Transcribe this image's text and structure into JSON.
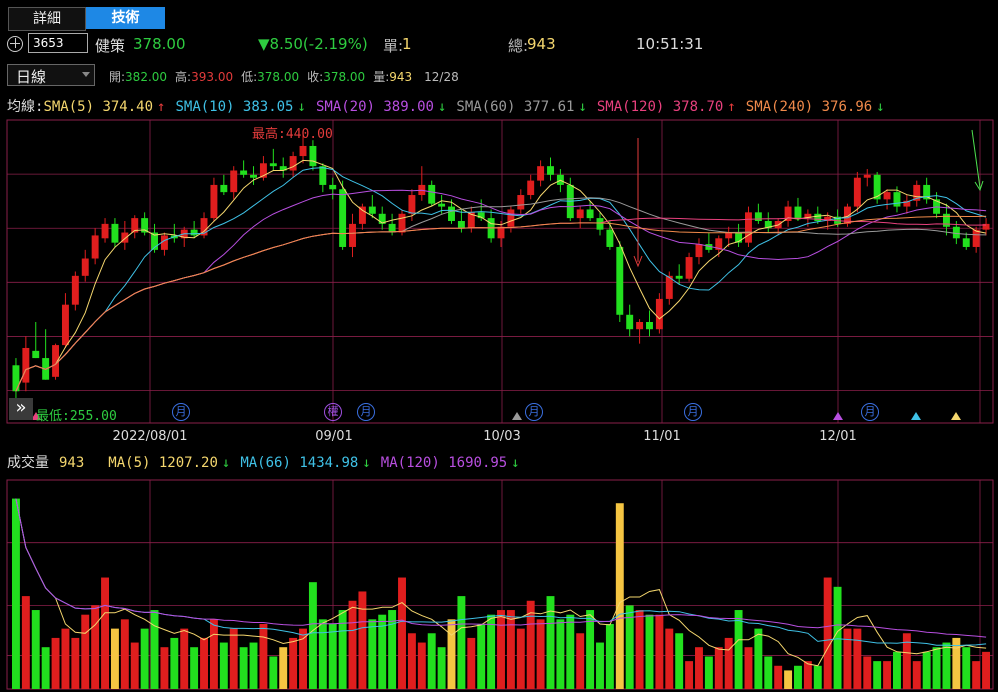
{
  "tabs": [
    {
      "label": "詳細",
      "active": false
    },
    {
      "label": "技術",
      "active": true
    }
  ],
  "quote": {
    "code": "3653",
    "name": "健策",
    "price": "378.00",
    "change": "▼8.50(-2.19%)",
    "unit_label": "單:",
    "unit_value": "1",
    "total_label": "總:",
    "total_value": "943",
    "time": "10:51:31"
  },
  "period": {
    "selected": "日線"
  },
  "ohlc": {
    "open_label": "開:",
    "open": "382.00",
    "high_label": "高:",
    "high": "393.00",
    "low_label": "低:",
    "low": "378.00",
    "close_label": "收:",
    "close": "378.00",
    "vol_label": "量:",
    "vol": "943",
    "date": "12/28"
  },
  "ma_title": "均線:",
  "ma": [
    {
      "label": "SMA(5)",
      "value": "374.40",
      "arrow": "↑",
      "color": "#f5d76e"
    },
    {
      "label": "SMA(10)",
      "value": "383.05",
      "arrow": "↓",
      "color": "#3fc1e6"
    },
    {
      "label": "SMA(20)",
      "value": "389.00",
      "arrow": "↓",
      "color": "#b84fe0"
    },
    {
      "label": "SMA(60)",
      "value": "377.61",
      "arrow": "↓",
      "color": "#9a9a9a"
    },
    {
      "label": "SMA(120)",
      "value": "378.70",
      "arrow": "↑",
      "color": "#e8417e"
    },
    {
      "label": "SMA(240)",
      "value": "376.96",
      "arrow": "↓",
      "color": "#f08a4b"
    }
  ],
  "annotations": {
    "high_label": "最高:",
    "high_value": "440.00",
    "low_label": "最低:",
    "low_value": "255.00",
    "expand_icon": "double-chevron-right-icon"
  },
  "event_markers": [
    {
      "label": "月",
      "type": "circle",
      "color": "#3a6fe0"
    },
    {
      "label": "權",
      "type": "circle",
      "color": "#a050e0"
    },
    {
      "label": "月",
      "type": "circle",
      "color": "#3a6fe0"
    },
    {
      "label": "月",
      "type": "circle",
      "color": "#3a6fe0"
    },
    {
      "label": "月",
      "type": "circle",
      "color": "#3a6fe0"
    },
    {
      "label": "月",
      "type": "circle",
      "color": "#3a6fe0"
    }
  ],
  "date_axis": [
    "2022/08/01",
    "09/01",
    "10/03",
    "11/01",
    "12/01"
  ],
  "volume_header": {
    "title": "成交量",
    "value": "943",
    "ma": [
      {
        "label": "MA(5)",
        "value": "1207.20",
        "arrow": "↓",
        "color": "#f5d76e"
      },
      {
        "label": "MA(66)",
        "value": "1434.98",
        "arrow": "↓",
        "color": "#3fc1e6"
      },
      {
        "label": "MA(120)",
        "value": "1690.95",
        "arrow": "↓",
        "color": "#b84fe0"
      }
    ]
  },
  "colors": {
    "up": "#e01e1e",
    "down": "#22e01e",
    "grid": "#8a1f4a",
    "text_green": "#2ecc40",
    "text_red": "#e23b3b",
    "text_yellow": "#f5d76e",
    "accent_tab": "#1e88e5"
  },
  "chart_data": {
    "type": "candlestick",
    "price_range": [
      240,
      450
    ],
    "volume_range": [
      0,
      4500
    ],
    "candles": [
      [
        280,
        285,
        250,
        262
      ],
      [
        268,
        300,
        262,
        292
      ],
      [
        290,
        310,
        285,
        285
      ],
      [
        285,
        305,
        270,
        270
      ],
      [
        272,
        295,
        270,
        294
      ],
      [
        294,
        330,
        292,
        322
      ],
      [
        322,
        345,
        318,
        342
      ],
      [
        342,
        360,
        338,
        354
      ],
      [
        354,
        375,
        350,
        370
      ],
      [
        368,
        382,
        365,
        378
      ],
      [
        378,
        382,
        362,
        365
      ],
      [
        365,
        380,
        360,
        372
      ],
      [
        372,
        384,
        368,
        382
      ],
      [
        382,
        386,
        370,
        372
      ],
      [
        372,
        378,
        358,
        360
      ],
      [
        360,
        372,
        356,
        370
      ],
      [
        370,
        378,
        365,
        368
      ],
      [
        368,
        376,
        362,
        374
      ],
      [
        374,
        380,
        368,
        370
      ],
      [
        370,
        386,
        368,
        382
      ],
      [
        382,
        410,
        380,
        405
      ],
      [
        405,
        412,
        398,
        400
      ],
      [
        400,
        418,
        395,
        415
      ],
      [
        415,
        422,
        410,
        412
      ],
      [
        412,
        418,
        405,
        410
      ],
      [
        410,
        425,
        408,
        420
      ],
      [
        420,
        430,
        415,
        418
      ],
      [
        418,
        424,
        410,
        415
      ],
      [
        415,
        428,
        410,
        425
      ],
      [
        425,
        440,
        420,
        432
      ],
      [
        432,
        436,
        415,
        418
      ],
      [
        418,
        420,
        400,
        405
      ],
      [
        405,
        410,
        395,
        402
      ],
      [
        402,
        408,
        360,
        362
      ],
      [
        362,
        385,
        355,
        378
      ],
      [
        378,
        392,
        374,
        390
      ],
      [
        390,
        398,
        382,
        385
      ],
      [
        385,
        390,
        374,
        378
      ],
      [
        378,
        385,
        370,
        372
      ],
      [
        372,
        388,
        370,
        385
      ],
      [
        385,
        402,
        380,
        398
      ],
      [
        398,
        418,
        394,
        405
      ],
      [
        405,
        408,
        390,
        392
      ],
      [
        392,
        398,
        385,
        390
      ],
      [
        390,
        395,
        378,
        380
      ],
      [
        380,
        388,
        372,
        375
      ],
      [
        375,
        390,
        372,
        386
      ],
      [
        386,
        395,
        380,
        382
      ],
      [
        382,
        388,
        365,
        368
      ],
      [
        368,
        380,
        362,
        376
      ],
      [
        376,
        390,
        372,
        388
      ],
      [
        388,
        402,
        385,
        398
      ],
      [
        398,
        412,
        395,
        408
      ],
      [
        408,
        422,
        404,
        418
      ],
      [
        418,
        424,
        408,
        412
      ],
      [
        412,
        416,
        400,
        405
      ],
      [
        405,
        410,
        380,
        382
      ],
      [
        382,
        390,
        375,
        388
      ],
      [
        388,
        394,
        380,
        382
      ],
      [
        382,
        386,
        370,
        374
      ],
      [
        374,
        380,
        360,
        362
      ],
      [
        362,
        366,
        310,
        315
      ],
      [
        315,
        322,
        300,
        305
      ],
      [
        305,
        312,
        295,
        310
      ],
      [
        310,
        318,
        300,
        305
      ],
      [
        305,
        330,
        302,
        326
      ],
      [
        326,
        345,
        322,
        342
      ],
      [
        342,
        350,
        336,
        340
      ],
      [
        340,
        358,
        338,
        355
      ],
      [
        355,
        368,
        350,
        364
      ],
      [
        364,
        372,
        358,
        360
      ],
      [
        360,
        370,
        355,
        368
      ],
      [
        368,
        376,
        362,
        372
      ],
      [
        372,
        378,
        362,
        365
      ],
      [
        365,
        390,
        362,
        386
      ],
      [
        386,
        392,
        378,
        380
      ],
      [
        380,
        386,
        372,
        375
      ],
      [
        375,
        382,
        370,
        380
      ],
      [
        380,
        394,
        376,
        390
      ],
      [
        390,
        396,
        380,
        382
      ],
      [
        382,
        388,
        376,
        385
      ],
      [
        385,
        390,
        378,
        380
      ],
      [
        380,
        386,
        374,
        383
      ],
      [
        383,
        388,
        376,
        378
      ],
      [
        378,
        392,
        376,
        390
      ],
      [
        390,
        414,
        386,
        410
      ],
      [
        410,
        416,
        404,
        412
      ],
      [
        412,
        414,
        392,
        395
      ],
      [
        395,
        402,
        388,
        400
      ],
      [
        400,
        404,
        386,
        390
      ],
      [
        390,
        398,
        385,
        394
      ],
      [
        394,
        408,
        390,
        405
      ],
      [
        405,
        410,
        392,
        395
      ],
      [
        395,
        400,
        382,
        385
      ],
      [
        385,
        392,
        370,
        376
      ],
      [
        376,
        380,
        364,
        368
      ],
      [
        368,
        372,
        360,
        362
      ],
      [
        362,
        376,
        358,
        374
      ],
      [
        374,
        382,
        370,
        378
      ]
    ],
    "volumes": [
      4100,
      2000,
      1700,
      900,
      1100,
      1300,
      1100,
      1600,
      1800,
      2400,
      1300,
      1500,
      1000,
      1300,
      1700,
      900,
      1100,
      1300,
      900,
      1100,
      1500,
      1000,
      1300,
      900,
      1000,
      1400,
      700,
      900,
      1100,
      1300,
      2300,
      1500,
      1400,
      1700,
      1900,
      2100,
      1500,
      1600,
      1700,
      2400,
      1200,
      1000,
      1200,
      900,
      1500,
      2000,
      1100,
      1400,
      1600,
      1700,
      1700,
      1300,
      1900,
      1500,
      2000,
      1500,
      1600,
      1200,
      1700,
      1000,
      1400,
      4000,
      1800,
      1700,
      1600,
      1600,
      1300,
      1200,
      600,
      900,
      700,
      900,
      1100,
      1700,
      900,
      1300,
      700,
      500,
      400,
      500,
      600,
      500,
      2400,
      2200,
      1300,
      1300,
      700,
      600,
      600,
      800,
      1200,
      600,
      800,
      900,
      1000,
      1100,
      900,
      600,
      800
    ]
  }
}
